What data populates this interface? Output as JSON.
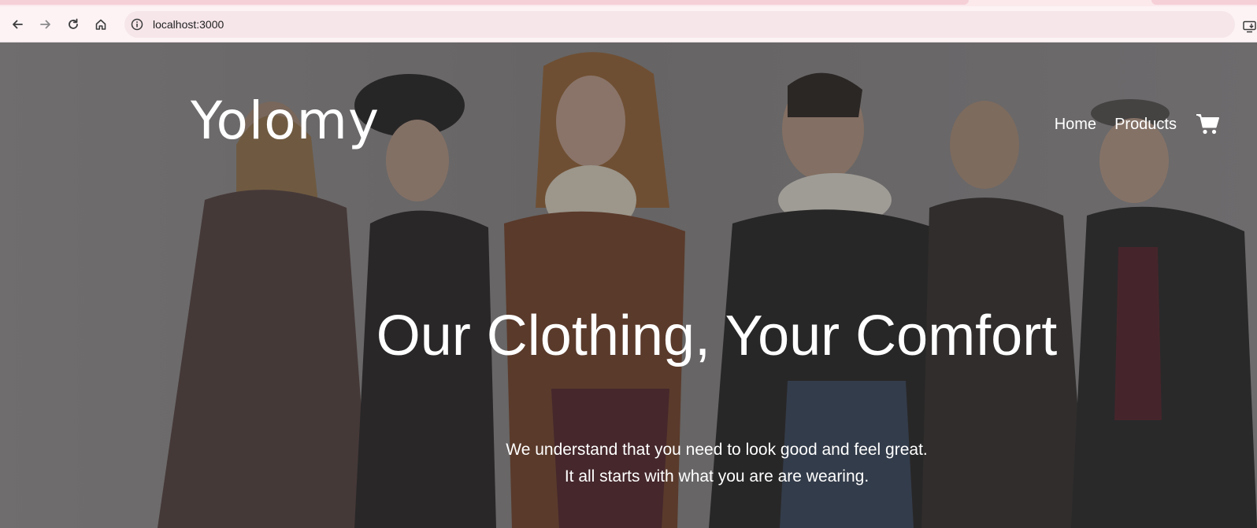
{
  "browser": {
    "url": "localhost:3000"
  },
  "site": {
    "logo": "Yolomy",
    "nav": {
      "home": "Home",
      "products": "Products"
    }
  },
  "hero": {
    "headline": "Our Clothing, Your Comfort",
    "subline_1": "We understand that you need to look good and feel great.",
    "subline_2": "It all starts with what you are are wearing."
  },
  "icons": {
    "back": "arrow-left-icon",
    "forward": "arrow-right-icon",
    "reload": "reload-icon",
    "home": "home-icon",
    "site_info": "info-icon",
    "install": "install-app-icon",
    "cart": "shopping-cart-icon"
  },
  "colors": {
    "chrome_bg": "#fdf3f5",
    "omnibox_bg": "#f6e6ea",
    "hero_text": "#ffffff"
  }
}
